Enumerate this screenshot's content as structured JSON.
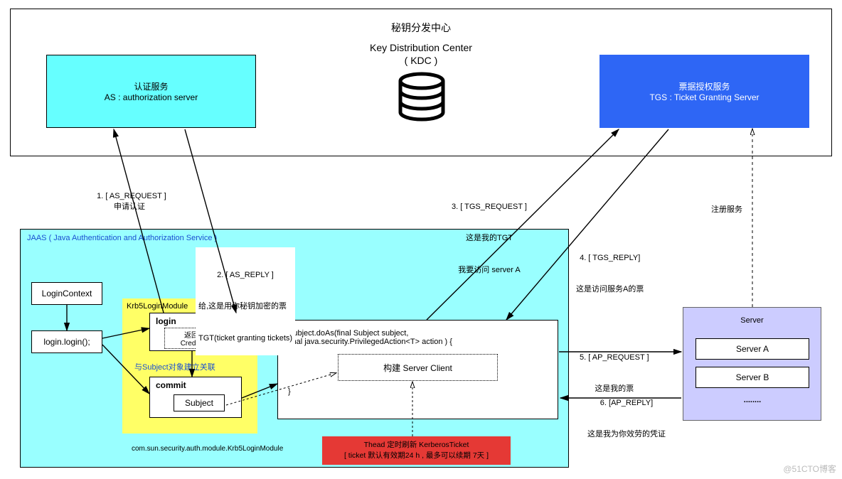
{
  "kdc": {
    "title_cn": "秘钥分发中心",
    "title_en": "Key Distribution Center",
    "abbr": "( KDC )",
    "as": {
      "title_cn": "认证服务",
      "title_en": "AS : authorization server"
    },
    "tgs": {
      "title_cn": "票据授权服务",
      "title_en": "TGS : Ticket Granting Server"
    }
  },
  "jaas": {
    "title": "JAAS ( Java Authentication and Authorization Service )",
    "login_context": "LoginContext",
    "login_call": "login.login();",
    "krb5_module_label": "Krb5LoginModule",
    "login_box": "login",
    "credentials_cn": "返回凭证",
    "credentials_en": "Credentials",
    "assoc_label": "与Subject对象建立关联",
    "commit_box": "commit",
    "subject_box": "Subject",
    "module_path": "com.sun.security.auth.module.Krb5LoginModule",
    "doAs_line1": "Subject.doAs(final Subject subject,",
    "doAs_line2": "                              final java.security.PrivilegedAction<T> action ) {",
    "doAs_inner": "构建 Server Client",
    "doAs_close": "}"
  },
  "server": {
    "title": "Server",
    "a": "Server A",
    "b": "Server B",
    "dots": "........"
  },
  "steps": {
    "s1": "1. [ AS_REQUEST ]",
    "s1b": "申请认证",
    "s2a": "2. [ AS_REPLY ]",
    "s2b": "给,这是用你秘钥加密的票",
    "s2c": "TGT(ticket granting tickets)",
    "s3a": "3. [ TGS_REQUEST ]",
    "s3b": "这是我的TGT",
    "s3c": "我要访问 server A",
    "s4a": "4. [ TGS_REPLY]",
    "s4b": "这是访问服务A的票",
    "s5a": "5. [ AP_REQUEST ]",
    "s5b": "这是我的票",
    "s6a": "6. [AP_REPLY]",
    "s6b": "这是我为你效劳的凭证",
    "reg": "注册服务"
  },
  "thread_note": {
    "line1": "Thead 定时刷新 KerberosTicket",
    "line2": "[ ticket 默认有效期24 h , 最多可以续期 7天 ]"
  },
  "watermark": "@51CTO博客"
}
